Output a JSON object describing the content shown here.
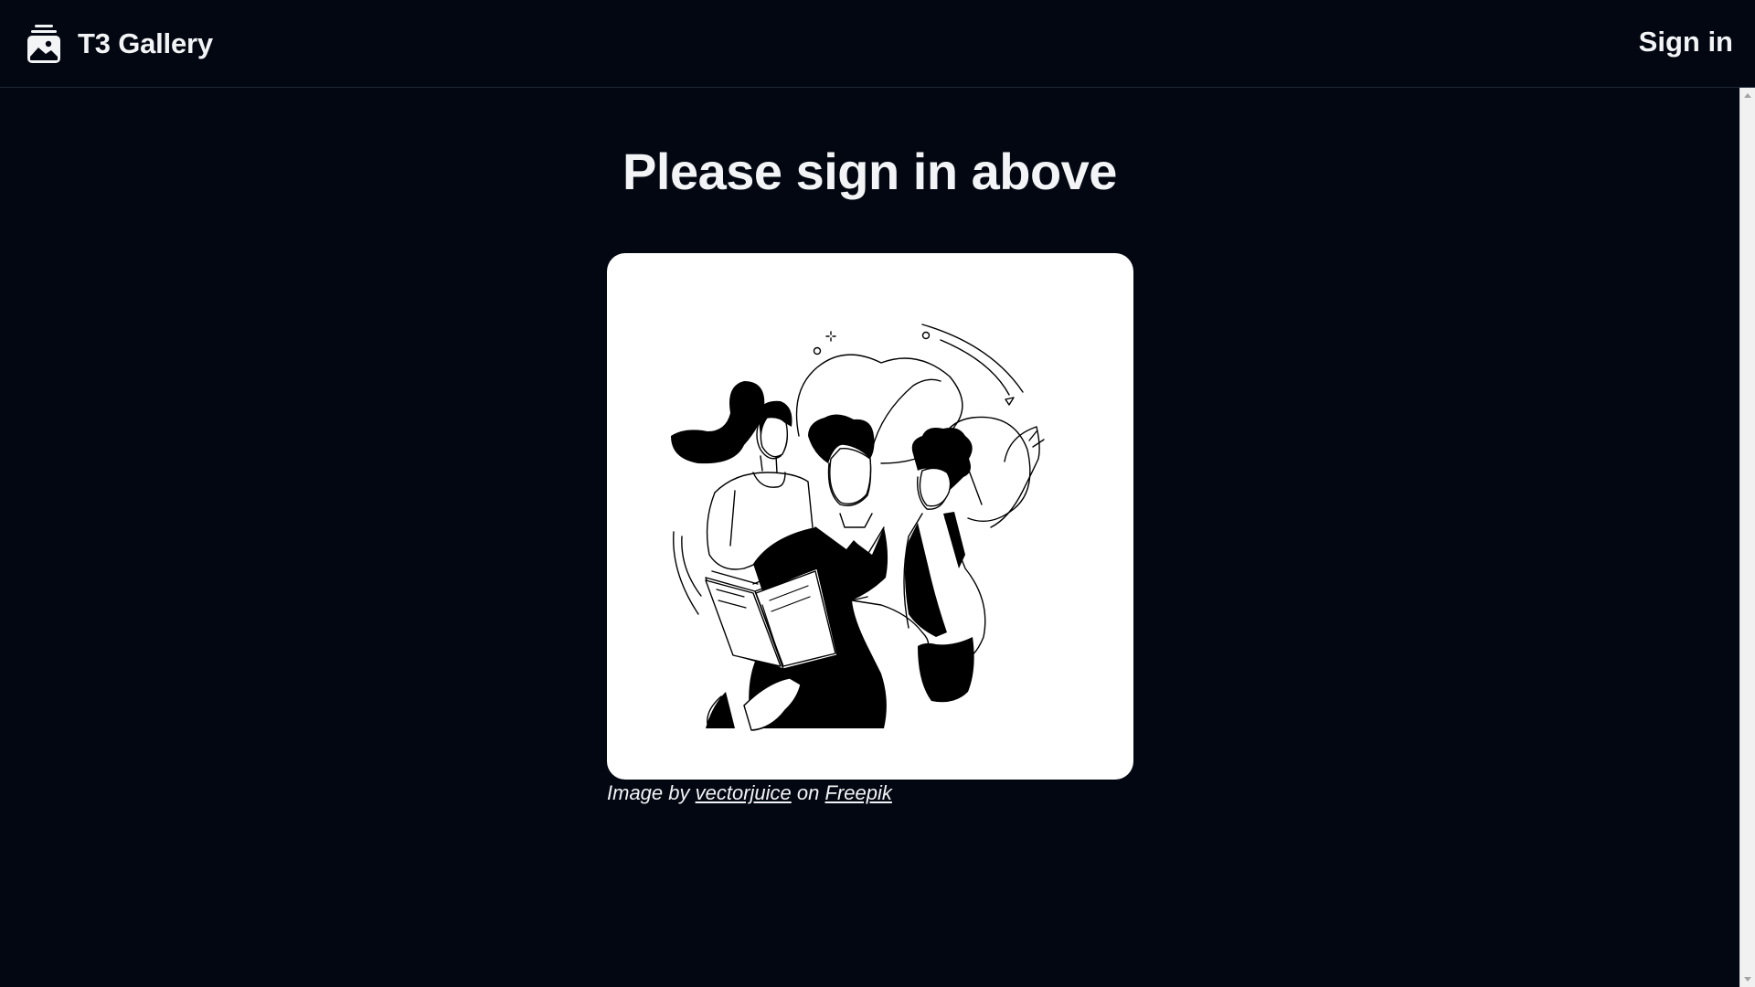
{
  "app": {
    "title": "T3 Gallery",
    "logo_icon": "photo-album-icon"
  },
  "header": {
    "signin_label": "Sign in"
  },
  "main": {
    "heading": "Please sign in above",
    "illustration": {
      "icon": "people-reading-book-illustration"
    },
    "credit": {
      "prefix": "Image by",
      "author": "vectorjuice",
      "middle": "on",
      "source": "Freepik"
    }
  },
  "colors": {
    "background": "#030712",
    "text": "#f3f4f6",
    "card": "#ffffff",
    "border": "#1f2937"
  }
}
